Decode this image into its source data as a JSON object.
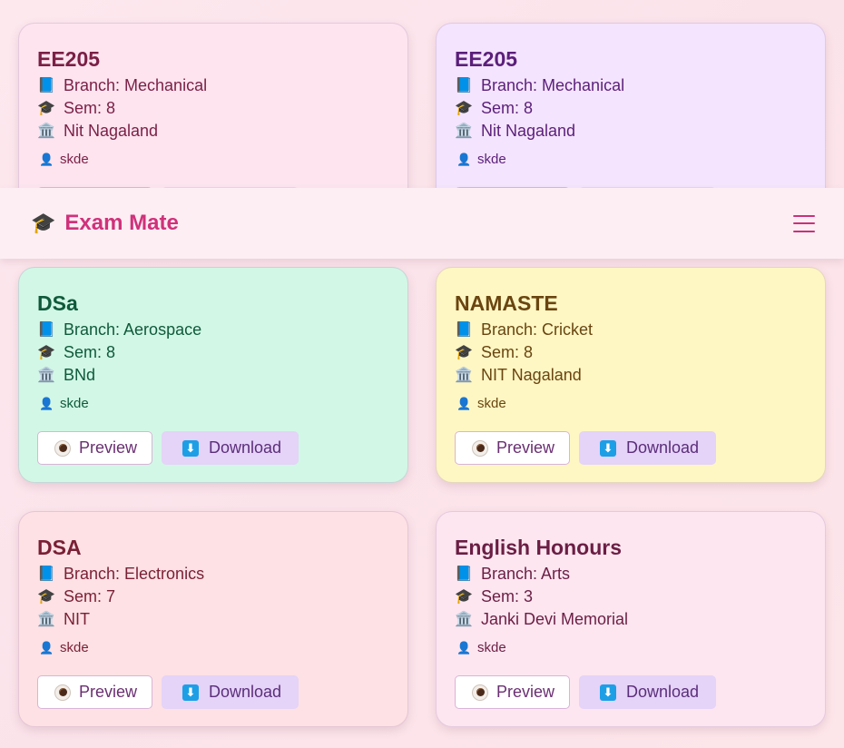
{
  "app": {
    "brand_icon": "graduation-cap",
    "brand_name": "Exam Mate",
    "menu_icon": "hamburger-menu"
  },
  "labels": {
    "preview": "Preview",
    "download": "Download"
  },
  "cards": [
    {
      "title": "EE205",
      "branch": "Branch: Mechanical",
      "sem": "Sem: 8",
      "college": "Nit Nagaland",
      "user": "skde"
    },
    {
      "title": "EE205",
      "branch": "Branch: Mechanical",
      "sem": "Sem: 8",
      "college": "Nit Nagaland",
      "user": "skde"
    },
    {
      "title": "DSa",
      "branch": "Branch: Aerospace",
      "sem": "Sem: 8",
      "college": "BNd",
      "user": "skde"
    },
    {
      "title": "NAMASTE",
      "branch": "Branch: Cricket",
      "sem": "Sem: 8",
      "college": "NIT Nagaland",
      "user": "skde"
    },
    {
      "title": "DSA",
      "branch": "Branch: Electronics",
      "sem": "Sem: 7",
      "college": "NIT",
      "user": "skde"
    },
    {
      "title": "English Honours",
      "branch": "Branch: Arts",
      "sem": "Sem: 3",
      "college": "Janki Devi Memorial",
      "user": "skde"
    }
  ],
  "colors": {
    "brand": "#d0317a",
    "download_bg": "#e5d3f8"
  }
}
